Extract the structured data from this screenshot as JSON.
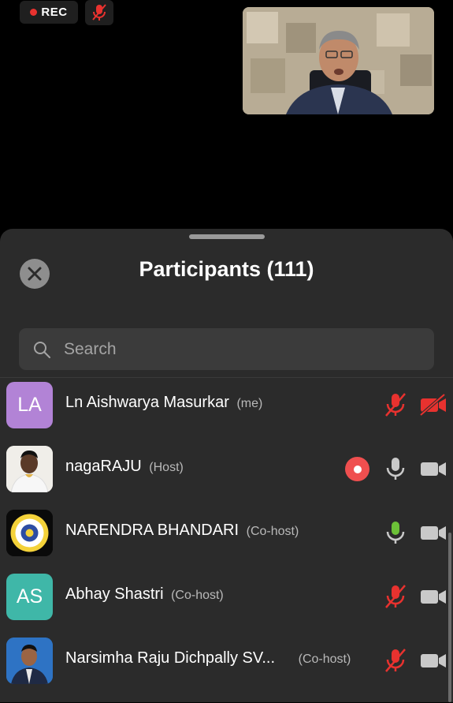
{
  "meeting": {
    "rec_label": "REC",
    "mute_status": "muted"
  },
  "panel": {
    "title": "Participants (111)",
    "search_placeholder": "Search"
  },
  "participants": [
    {
      "initials": "LA",
      "name": "Ln Aishwarya Masurkar",
      "role": "(me)",
      "avatar_color": "#b283d6",
      "mic": "muted",
      "video": "off",
      "recording": false
    },
    {
      "initials": "",
      "name": "nagaRAJU",
      "role": "(Host)",
      "avatar_color": "#f2f2f2",
      "mic": "unmuted",
      "video": "on",
      "recording": true
    },
    {
      "initials": "",
      "name": "NARENDRA BHANDARI",
      "role": "(Co-host)",
      "avatar_color": "#0a0a0a",
      "mic": "speaking",
      "video": "on",
      "recording": false
    },
    {
      "initials": "AS",
      "name": "Abhay Shastri",
      "role": "(Co-host)",
      "avatar_color": "#3fb7a8",
      "mic": "muted",
      "video": "on",
      "recording": false
    },
    {
      "initials": "",
      "name": "Narsimha Raju Dichpally SV...",
      "role": "(Co-host)",
      "avatar_color": "#2e73c4",
      "mic": "muted",
      "video": "on",
      "recording": false
    }
  ],
  "colors": {
    "mute_red": "#e8322f",
    "speaking_green": "#6cc138",
    "icon_grey": "#c9c9c9"
  }
}
